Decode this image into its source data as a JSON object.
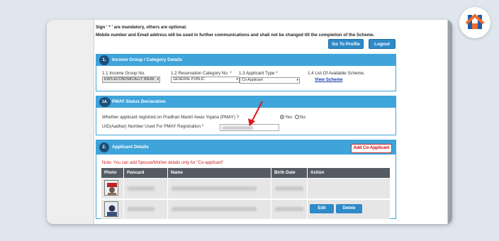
{
  "notice": {
    "line1": "Sign ' * ' are mandatory, others are optional.",
    "line2": "Mobile number and Email address will be used in further communications and shall not be changed till the completion of the Scheme."
  },
  "header_buttons": {
    "profile": "Go To Profile",
    "logout": "Logout"
  },
  "section1": {
    "step": "1.",
    "title": "Income Group / Category Details",
    "fields": [
      {
        "label": "1.1 Income Group No.",
        "value": "EWS-ECONOMICALLY WEAK"
      },
      {
        "label": "1.2 Reservation Category No. *",
        "value": "GENERAL PUBLIC"
      },
      {
        "label": "1.3 Applicant Type *",
        "value": "Co-Applicant"
      },
      {
        "label": "1.4 List Of Available Scheme.",
        "link": "View Scheme"
      }
    ]
  },
  "section1a": {
    "step": "1A.",
    "title": "PMAY Status Declaration",
    "question": "Whether applicant registred on Pradhan Mantri Awas Yojana (PMAY) ?",
    "yes": "Yes",
    "no": "No",
    "uid_label": "UID(Aadhar) Number Used For PMAY Registration *"
  },
  "section2": {
    "step": "2.",
    "title": "Applicant Details",
    "add_button": "Add Co-Applicant",
    "note": "Note: You can add Spouse/Mother details only for \"Co-applicant\"",
    "columns": [
      "Photo",
      "Pancard",
      "Name",
      "Birth Date",
      "Action"
    ],
    "row_actions": {
      "edit": "Edit",
      "delete": "Delete"
    }
  },
  "colors": {
    "accent": "#3ea4da",
    "button": "#2e8ac8",
    "header_dark": "#555b63",
    "note": "#d02020",
    "arrow": "#e01818"
  },
  "icons": {
    "logo": "home-logo-icon",
    "arrow": "red-pointer-arrow-icon"
  }
}
